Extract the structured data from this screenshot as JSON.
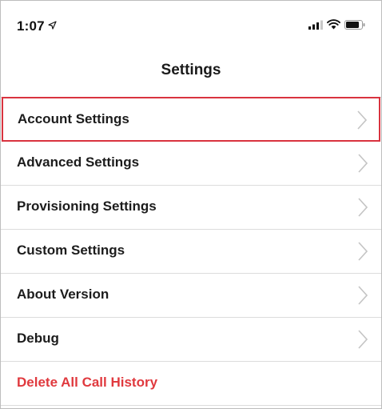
{
  "status_bar": {
    "time": "1:07",
    "location_icon": "location-arrow-icon",
    "signal_icon": "signal-icon",
    "wifi_icon": "wifi-icon",
    "battery_icon": "battery-icon"
  },
  "nav": {
    "title": "Settings"
  },
  "settings": {
    "items": [
      {
        "label": "Account Settings",
        "icon": "chevron-right-icon"
      },
      {
        "label": "Advanced Settings",
        "icon": "chevron-right-icon"
      },
      {
        "label": "Provisioning Settings",
        "icon": "chevron-right-icon"
      },
      {
        "label": "Custom Settings",
        "icon": "chevron-right-icon"
      },
      {
        "label": "About Version",
        "icon": "chevron-right-icon"
      },
      {
        "label": "Debug",
        "icon": "chevron-right-icon"
      },
      {
        "label": "Delete All Call History"
      }
    ],
    "highlight_color": "#d9333f",
    "danger_color": "#e0393e"
  }
}
